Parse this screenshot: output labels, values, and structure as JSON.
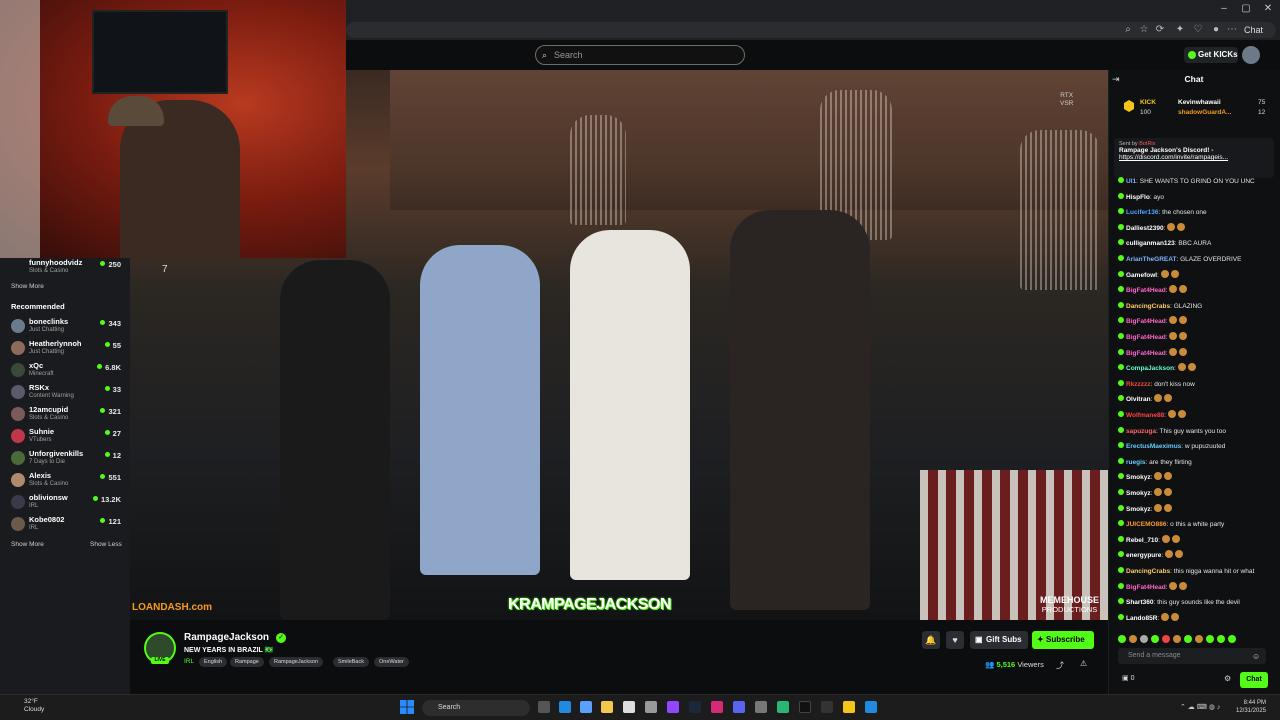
{
  "browser": {
    "window_buttons": [
      "–",
      "▢",
      "✕"
    ],
    "chat_label": "Chat"
  },
  "header": {
    "search_placeholder": "Search",
    "get_kicks": "Get KICKs"
  },
  "sidebar": {
    "top_item": {
      "name": "funnyhoodvidz",
      "category": "Slots & Casino",
      "viewers": "250"
    },
    "show_more_1": "Show More",
    "recommended_title": "Recommended",
    "items": [
      {
        "name": "boneclinks",
        "category": "Just Chatting",
        "viewers": "343"
      },
      {
        "name": "Heatherlynnoh",
        "category": "Just Chatting",
        "viewers": "55"
      },
      {
        "name": "xQc",
        "category": "Minecraft",
        "viewers": "6.8K"
      },
      {
        "name": "RSKx",
        "category": "Content Warning",
        "viewers": "33"
      },
      {
        "name": "12amcupid",
        "category": "Slots & Casino",
        "viewers": "321"
      },
      {
        "name": "Suhnie",
        "category": "VTubers",
        "viewers": "27"
      },
      {
        "name": "Unforgivenkills",
        "category": "7 Days to Die",
        "viewers": "12"
      },
      {
        "name": "Alexis",
        "category": "Slots & Casino",
        "viewers": "551"
      },
      {
        "name": "oblivionsw",
        "category": "IRL",
        "viewers": "13.2K"
      },
      {
        "name": "Kobe0802",
        "category": "IRL",
        "viewers": "121"
      }
    ],
    "show_more_2": "Show More",
    "show_less": "Show Less"
  },
  "video": {
    "rtx": "RTX",
    "vsr": "VSR",
    "loandash": "LOANDASH.com",
    "overlay_name": "KRAMPAGEJACKSON",
    "memehouse": "MEMEHOUSE",
    "productions": "PRODUCTIONS",
    "top_left_number": "7"
  },
  "stream": {
    "channel": "RampageJackson",
    "live": "LIVE",
    "title": "NEW YEARS IN BRAZIL 🇧🇷",
    "category": "IRL",
    "tags": [
      "English",
      "Rampage",
      "RampageJackson",
      "SmileBack",
      "OneWater"
    ],
    "gift_subs": "Gift Subs",
    "subscribe": "Subscribe",
    "viewers": "5,516",
    "viewers_label": "Viewers"
  },
  "chat": {
    "title": "Chat",
    "kick_label": "KICK",
    "kick_amount": "100",
    "leader_1": {
      "name": "Kevinwhawaii",
      "value": "75"
    },
    "leader_2": {
      "name": "shadowGuardA...",
      "value": "12"
    },
    "pinned_sent_by": "Sent by",
    "pinned_sender": "BotRix",
    "pinned_text": "Rampage Jackson's Discord! -",
    "pinned_link": "https://discord.com/invite/rampageis...",
    "messages": [
      {
        "user": "Ul1",
        "text": "SHE WANTS TO GRIND ON YOU UNC",
        "color": "#7fb3ff"
      },
      {
        "user": "HispFlo",
        "text": "ayo",
        "color": "#ffffff"
      },
      {
        "user": "Lucifer136",
        "text": "the chosen one",
        "color": "#53a9ff"
      },
      {
        "user": "Dalliest2390",
        "text": "",
        "color": "#ffffff"
      },
      {
        "user": "culliganman123",
        "text": "BBC AURA",
        "color": "#ffffff"
      },
      {
        "user": "ArianTheGREAT",
        "text": "GLAZE OVERDRIVE",
        "color": "#7fb3ff"
      },
      {
        "user": "Gamefowl",
        "text": "",
        "color": "#ffffff"
      },
      {
        "user": "BigFat4Head",
        "text": "",
        "color": "#ff66cc"
      },
      {
        "user": "DancingCrabs",
        "text": "GLAZING",
        "color": "#ffcc66"
      },
      {
        "user": "BigFat4Head",
        "text": "",
        "color": "#ff66cc"
      },
      {
        "user": "BigFat4Head",
        "text": "",
        "color": "#ff66cc"
      },
      {
        "user": "BigFat4Head",
        "text": "",
        "color": "#ff66cc"
      },
      {
        "user": "CompaJackson",
        "text": "",
        "color": "#66ffcc"
      },
      {
        "user": "Rkzzzzz",
        "text": "don't kiss now",
        "color": "#ff4444"
      },
      {
        "user": "Olvitran",
        "text": "",
        "color": "#ffffff"
      },
      {
        "user": "Wolfmane88",
        "text": "",
        "color": "#ff4444"
      },
      {
        "user": "sapuzuga",
        "text": "This guy wants you too",
        "color": "#ff6666"
      },
      {
        "user": "ErectusMaeximus",
        "text": "w pupuzuuted",
        "color": "#66ccff"
      },
      {
        "user": "ruegis",
        "text": "are they flirting",
        "color": "#66ccff"
      },
      {
        "user": "Smokyz",
        "text": "",
        "color": "#ffffff"
      },
      {
        "user": "Smokyz",
        "text": "",
        "color": "#ffffff"
      },
      {
        "user": "Smokyz",
        "text": "",
        "color": "#ffffff"
      },
      {
        "user": "JUICEMO886",
        "text": "o this a white party",
        "color": "#ff9933"
      },
      {
        "user": "Rebel_710",
        "text": "",
        "color": "#ffffff"
      },
      {
        "user": "energypure",
        "text": "",
        "color": "#ffffff"
      },
      {
        "user": "DancingCrabs",
        "text": "this nigga wanna hit or what",
        "color": "#ffcc66"
      },
      {
        "user": "BigFat4Head",
        "text": "",
        "color": "#ff66cc"
      },
      {
        "user": "Shart360",
        "text": "this guy sounds like the devil",
        "color": "#ffffff"
      },
      {
        "user": "Lando85R",
        "text": "",
        "color": "#ffffff"
      }
    ],
    "input_placeholder": "Send a message",
    "points": "0",
    "chat_button": "Chat"
  },
  "taskbar": {
    "temp": "32°F",
    "weather": "Cloudy",
    "search": "Search",
    "time": "8:44 PM",
    "date": "12/31/2025"
  },
  "colors": {
    "kick_green": "#53fc18",
    "bg": "#0b0d0e"
  }
}
